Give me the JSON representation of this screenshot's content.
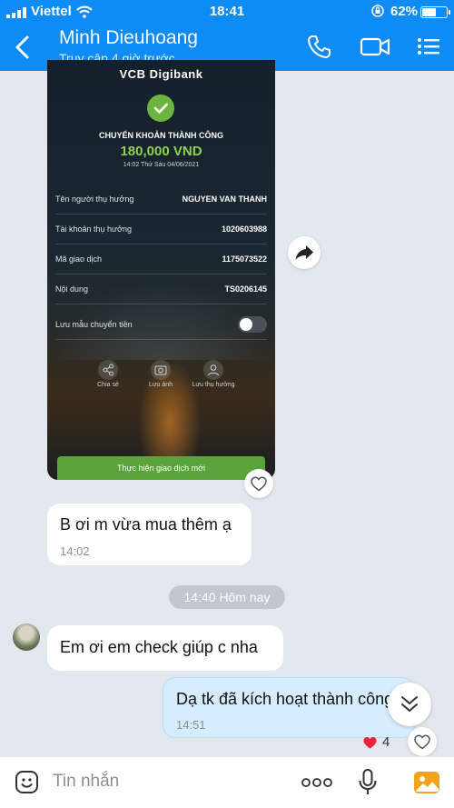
{
  "status_bar": {
    "carrier": "Viettel",
    "time": "18:41",
    "battery": "62%",
    "battery_level": 0.62
  },
  "header": {
    "title": "Minh Dieuhoang",
    "subtitle": "Truy cập 4 giờ trước"
  },
  "receipt": {
    "brand": "VCB Digibank",
    "success": "CHUYỂN KHOẢN THÀNH CÔNG",
    "amount": "180,000 VND",
    "datetime": "14:02 Thứ Sáu 04/06/2021",
    "rows": [
      {
        "label": "Tên người thụ hưởng",
        "value": "NGUYEN VAN THANH"
      },
      {
        "label": "Tài khoản thụ hưởng",
        "value": "1020603988"
      },
      {
        "label": "Mã giao dịch",
        "value": "1175073522"
      },
      {
        "label": "Nội dung",
        "value": "TS0206145"
      }
    ],
    "save_template": {
      "label": "Lưu mẫu chuyển tiền",
      "on": false
    },
    "actions": [
      "Chia sẻ",
      "Lưu ảnh",
      "Lưu thụ hưởng"
    ],
    "new_transaction": "Thực hiện giao dịch mới"
  },
  "messages": [
    {
      "text": "B ơi m vừa mua thêm ạ",
      "time": "14:02"
    },
    {
      "text": "Em ơi em check giúp c nha"
    },
    {
      "text": "Dạ tk đã kích hoạt thành công ạ",
      "time": "14:51"
    }
  ],
  "day_separator": "14:40 Hôm nay",
  "reaction": {
    "icon": "heart-icon",
    "count": "4"
  },
  "composer": {
    "placeholder": "Tin nhắn"
  },
  "colors": {
    "header": "#0d8bf7",
    "outgoing": "#d6ecff",
    "incoming": "#ffffff",
    "chat_bg": "#e3e8ee"
  }
}
